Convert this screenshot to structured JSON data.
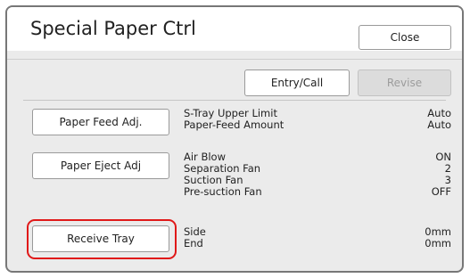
{
  "title": "Special Paper Ctrl",
  "buttons": {
    "close": "Close",
    "entry_call": "Entry/Call",
    "revise": "Revise",
    "paper_feed_adj": "Paper Feed Adj.",
    "paper_eject_adj": "Paper Eject Adj",
    "receive_tray": "Receive Tray"
  },
  "settings": {
    "paper_feed": [
      {
        "label": "S-Tray Upper Limit",
        "value": "Auto"
      },
      {
        "label": "Paper-Feed Amount",
        "value": "Auto"
      }
    ],
    "paper_eject": [
      {
        "label": "Air Blow",
        "value": "ON"
      },
      {
        "label": "Separation Fan",
        "value": "2"
      },
      {
        "label": "Suction Fan",
        "value": "3"
      },
      {
        "label": "Pre-suction Fan",
        "value": "OFF"
      }
    ],
    "receive_tray": [
      {
        "label": "Side",
        "value": "0mm"
      },
      {
        "label": "End",
        "value": "0mm"
      }
    ]
  },
  "colors": {
    "highlight": "#e01919",
    "disabled_button": "#dcdcdc"
  }
}
